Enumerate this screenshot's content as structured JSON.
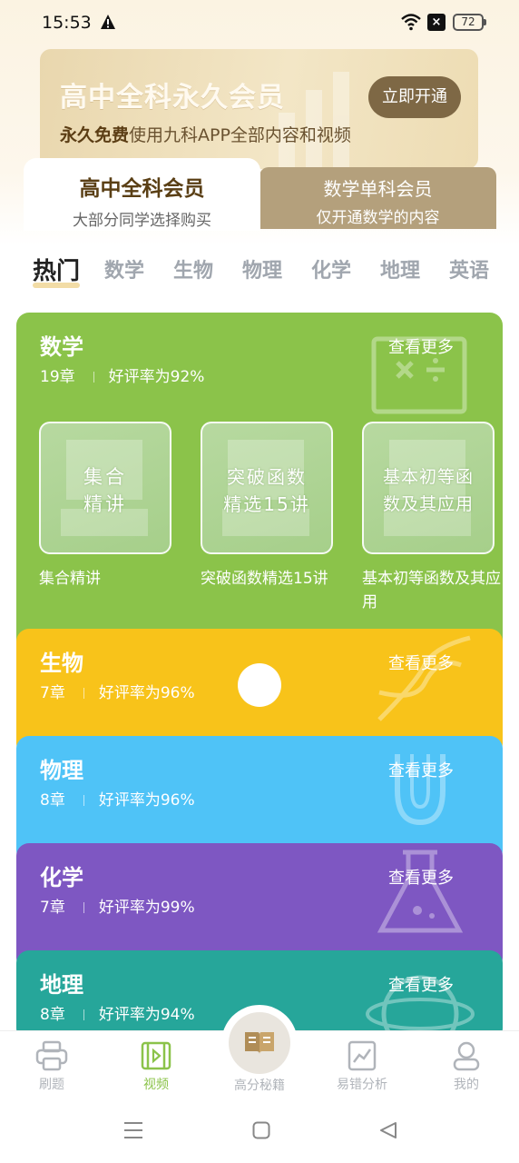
{
  "status": {
    "time": "15:53",
    "battery": "72"
  },
  "banner": {
    "title": "高中全科永久会员",
    "sub_bold": "永久免费",
    "sub_rest": "使用九科APP全部内容和视频",
    "button": "立即开通"
  },
  "member_tabs": [
    {
      "title": "高中全科会员",
      "sub": "大部分同学选择购买"
    },
    {
      "title": "数学单科会员",
      "sub": "仅开通数学的内容"
    }
  ],
  "subject_tabs": [
    "热门",
    "数学",
    "生物",
    "物理",
    "化学",
    "地理",
    "英语"
  ],
  "active_subject": "热门",
  "cards": [
    {
      "title": "数学",
      "chapters": "19章",
      "rating": "好评率为92%",
      "more": "查看更多",
      "color": "#8bc34a",
      "courses": [
        {
          "thumb_line1": "集合",
          "thumb_line2": "精讲",
          "name": "集合精讲"
        },
        {
          "thumb_line1": "突破函数",
          "thumb_line2": "精选15讲",
          "name": "突破函数精选15讲"
        },
        {
          "thumb_line1": "基本初等函",
          "thumb_line2": "数及其应用",
          "name": "基本初等函数及其应用"
        }
      ]
    },
    {
      "title": "生物",
      "chapters": "7章",
      "rating": "好评率为96%",
      "more": "查看更多",
      "color": "#f8c31a"
    },
    {
      "title": "物理",
      "chapters": "8章",
      "rating": "好评率为96%",
      "more": "查看更多",
      "color": "#4fc3f7"
    },
    {
      "title": "化学",
      "chapters": "7章",
      "rating": "好评率为99%",
      "more": "查看更多",
      "color": "#7e57c2"
    },
    {
      "title": "地理",
      "chapters": "8章",
      "rating": "好评率为94%",
      "more": "查看更多",
      "color": "#26a69a"
    }
  ],
  "bottom_nav": [
    {
      "label": "刷题",
      "icon": "printer-icon"
    },
    {
      "label": "视频",
      "icon": "video-icon"
    },
    {
      "label": "高分秘籍",
      "icon": "book-icon"
    },
    {
      "label": "易错分析",
      "icon": "chart-icon"
    },
    {
      "label": "我的",
      "icon": "user-icon"
    }
  ],
  "active_nav": "视频"
}
